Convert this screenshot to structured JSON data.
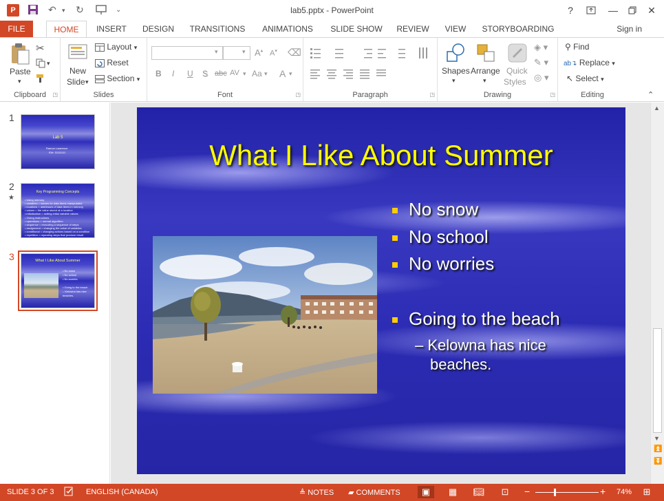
{
  "window": {
    "doc_title": "lab5.pptx - PowerPoint",
    "app_icon_letter": "P",
    "help": "?",
    "minimize": "—",
    "close": "✕"
  },
  "tabs": [
    {
      "label": "FILE"
    },
    {
      "label": "HOME"
    },
    {
      "label": "INSERT"
    },
    {
      "label": "DESIGN"
    },
    {
      "label": "TRANSITIONS"
    },
    {
      "label": "ANIMATIONS"
    },
    {
      "label": "SLIDE SHOW"
    },
    {
      "label": "REVIEW"
    },
    {
      "label": "VIEW"
    },
    {
      "label": "STORYBOARDING"
    }
  ],
  "signin": "Sign in",
  "ribbon": {
    "clipboard": {
      "label": "Clipboard",
      "paste": "Paste"
    },
    "slides": {
      "label": "Slides",
      "new_slide_1": "New",
      "new_slide_2": "Slide",
      "layout": "Layout",
      "reset": "Reset",
      "section": "Section"
    },
    "font": {
      "label": "Font",
      "bold": "B",
      "italic": "I",
      "underline": "U",
      "shadow": "S",
      "strike": "abc",
      "spacing": "AV",
      "case": "Aa",
      "color": "A"
    },
    "paragraph": {
      "label": "Paragraph"
    },
    "drawing": {
      "label": "Drawing",
      "shapes": "Shapes",
      "arrange": "Arrange",
      "quick_1": "Quick",
      "quick_2": "Styles"
    },
    "editing": {
      "label": "Editing",
      "find": "Find",
      "replace": "Replace",
      "select": "Select"
    }
  },
  "thumbnails": [
    {
      "number": "1",
      "title": "Lab 5",
      "lines": [
        "Ramon Lawrence",
        "ID#: 11111111"
      ]
    },
    {
      "number": "2",
      "title": "Key Programming Concepts",
      "lines": [
        "• Using memory",
        "   • variables = names for data items manipulated",
        "   • locations = addresses of data items in memory",
        "   • values = the value stored at a location",
        "   • initialization = setting initial variable values",
        "• Giving instructions",
        "   • operations = normal algorithm",
        "   • sequence = executing a sequence of steps",
        "   • assignment = changing the value of variables",
        "   • conditional = changing actions based on a condition",
        "   • repetition = repeating steps that produce result"
      ]
    },
    {
      "number": "3",
      "title": "What I Like About Summer",
      "lines": [
        "• No snow",
        "• No school",
        "• No worries",
        "• Going to the beach",
        "   – Kelowna has nice",
        "      beaches."
      ]
    }
  ],
  "slide": {
    "title": "What I Like About Summer",
    "bullets": [
      "No snow",
      "No school",
      "No worries",
      "Going to the beach"
    ],
    "sub_line1": "– Kelowna has nice",
    "sub_line2": "beaches."
  },
  "status": {
    "slide_info": "SLIDE 3 OF 3",
    "language": "ENGLISH (CANADA)",
    "notes": "NOTES",
    "comments": "COMMENTS",
    "zoom_minus": "−",
    "zoom_plus": "+",
    "zoom": "74%"
  }
}
